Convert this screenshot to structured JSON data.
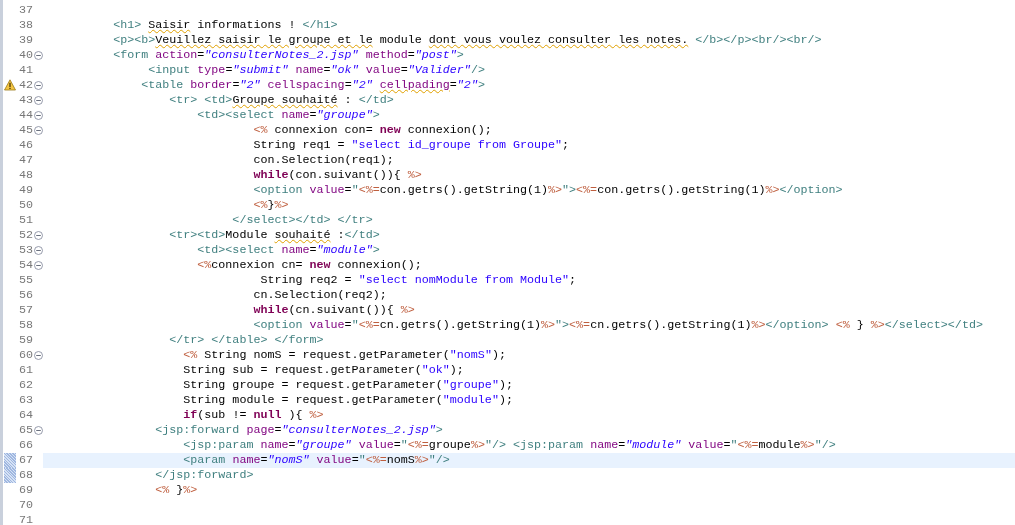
{
  "editor": {
    "lines": [
      {
        "number": "37",
        "fold": false,
        "warning": false,
        "changed": false,
        "current": false
      },
      {
        "number": "38",
        "fold": false,
        "warning": false,
        "changed": false,
        "current": false,
        "tokens": [
          {
            "kind": "tag",
            "text": "          <h1> "
          },
          {
            "kind": "misspelled",
            "text": "Saisir"
          },
          {
            "kind": "text",
            "text": " informations ! "
          },
          {
            "kind": "tag",
            "text": "</h1>"
          }
        ]
      },
      {
        "number": "39",
        "fold": false,
        "warning": false,
        "changed": false,
        "current": false,
        "tokens": [
          {
            "kind": "tag",
            "text": "          <p><b>"
          },
          {
            "kind": "misspelled",
            "text": "Veuillez saisir le groupe et le"
          },
          {
            "kind": "text",
            "text": " module "
          },
          {
            "kind": "misspelled",
            "text": "dont vous voulez consulter les notes."
          },
          {
            "kind": "tag",
            "text": " </b></p><br/><br/>"
          }
        ]
      },
      {
        "number": "40",
        "fold": true,
        "warning": false,
        "changed": false,
        "current": false,
        "tokens": [
          {
            "kind": "tag",
            "text": "          <form "
          },
          {
            "kind": "attr",
            "text": "action"
          },
          {
            "kind": "text",
            "text": "="
          },
          {
            "kind": "value",
            "text": "\"consulterNotes_2.jsp\" "
          },
          {
            "kind": "attr",
            "text": "method"
          },
          {
            "kind": "text",
            "text": "="
          },
          {
            "kind": "value",
            "text": "\"post\""
          },
          {
            "kind": "tag",
            "text": ">"
          }
        ]
      },
      {
        "number": "41",
        "fold": false,
        "warning": false,
        "changed": false,
        "current": false,
        "tokens": [
          {
            "kind": "tag",
            "text": "               <input "
          },
          {
            "kind": "attr",
            "text": "type"
          },
          {
            "kind": "text",
            "text": "="
          },
          {
            "kind": "value",
            "text": "\"submit\" "
          },
          {
            "kind": "attr",
            "text": "name"
          },
          {
            "kind": "text",
            "text": "="
          },
          {
            "kind": "value",
            "text": "\"ok\" "
          },
          {
            "kind": "attr",
            "text": "value"
          },
          {
            "kind": "text",
            "text": "="
          },
          {
            "kind": "value",
            "text": "\"Valider\""
          },
          {
            "kind": "tag",
            "text": "/>"
          }
        ]
      },
      {
        "number": "42",
        "fold": true,
        "warning": true,
        "changed": false,
        "current": false,
        "tokens": [
          {
            "kind": "tag",
            "text": "              <table "
          },
          {
            "kind": "attr",
            "text": "border"
          },
          {
            "kind": "text",
            "text": "="
          },
          {
            "kind": "value",
            "text": "\"2\" "
          },
          {
            "kind": "attr",
            "text": "cellspacing"
          },
          {
            "kind": "text",
            "text": "="
          },
          {
            "kind": "value",
            "text": "\"2\" "
          },
          {
            "kind": "misspelled-attr",
            "text": "cellpading"
          },
          {
            "kind": "text",
            "text": "="
          },
          {
            "kind": "value",
            "text": "\"2\""
          },
          {
            "kind": "tag",
            "text": ">"
          }
        ]
      },
      {
        "number": "43",
        "fold": true,
        "warning": false,
        "changed": false,
        "current": false,
        "tokens": [
          {
            "kind": "tag",
            "text": "                  <tr> <td>"
          },
          {
            "kind": "misspelled",
            "text": "Groupe souhaité"
          },
          {
            "kind": "text",
            "text": " : "
          },
          {
            "kind": "tag",
            "text": "</td>"
          }
        ]
      },
      {
        "number": "44",
        "fold": true,
        "warning": false,
        "changed": false,
        "current": false,
        "tokens": [
          {
            "kind": "tag",
            "text": "                      <td><select "
          },
          {
            "kind": "attr",
            "text": "name"
          },
          {
            "kind": "text",
            "text": "="
          },
          {
            "kind": "value",
            "text": "\"groupe\""
          },
          {
            "kind": "tag",
            "text": ">"
          }
        ]
      },
      {
        "number": "45",
        "fold": true,
        "warning": false,
        "changed": false,
        "current": false,
        "tokens": [
          {
            "kind": "jsp",
            "text": "                              <%"
          },
          {
            "kind": "text",
            "text": " connexion con= "
          },
          {
            "kind": "keyword",
            "text": "new"
          },
          {
            "kind": "text",
            "text": " connexion();"
          }
        ]
      },
      {
        "number": "46",
        "fold": false,
        "warning": false,
        "changed": false,
        "current": false,
        "tokens": [
          {
            "kind": "text",
            "text": "                              String req1 = "
          },
          {
            "kind": "string",
            "text": "\"select id_groupe from Groupe\""
          },
          {
            "kind": "text",
            "text": ";"
          }
        ]
      },
      {
        "number": "47",
        "fold": false,
        "warning": false,
        "changed": false,
        "current": false,
        "tokens": [
          {
            "kind": "text",
            "text": "                              con.Selection(req1);"
          }
        ]
      },
      {
        "number": "48",
        "fold": false,
        "warning": false,
        "changed": false,
        "current": false,
        "tokens": [
          {
            "kind": "keyword",
            "text": "                              while"
          },
          {
            "kind": "text",
            "text": "(con.suivant()){ "
          },
          {
            "kind": "jsp",
            "text": "%>"
          }
        ]
      },
      {
        "number": "49",
        "fold": false,
        "warning": false,
        "changed": false,
        "current": false,
        "tokens": [
          {
            "kind": "tag",
            "text": "                              <option "
          },
          {
            "kind": "attr",
            "text": "value"
          },
          {
            "kind": "text",
            "text": "="
          },
          {
            "kind": "quote",
            "text": "\""
          },
          {
            "kind": "jsp",
            "text": "<%="
          },
          {
            "kind": "text",
            "text": "con.getrs().getString(1)"
          },
          {
            "kind": "jsp",
            "text": "%>"
          },
          {
            "kind": "quote",
            "text": "\""
          },
          {
            "kind": "tag",
            "text": ">"
          },
          {
            "kind": "jsp",
            "text": "<%="
          },
          {
            "kind": "text",
            "text": "con.getrs().getString(1)"
          },
          {
            "kind": "jsp",
            "text": "%>"
          },
          {
            "kind": "tag",
            "text": "</option>"
          }
        ]
      },
      {
        "number": "50",
        "fold": false,
        "warning": false,
        "changed": false,
        "current": false,
        "tokens": [
          {
            "kind": "jsp",
            "text": "                              <%"
          },
          {
            "kind": "text",
            "text": "}"
          },
          {
            "kind": "jsp",
            "text": "%>"
          }
        ]
      },
      {
        "number": "51",
        "fold": false,
        "warning": false,
        "changed": false,
        "current": false,
        "tokens": [
          {
            "kind": "tag",
            "text": "                           </select></td> </tr>"
          }
        ]
      },
      {
        "number": "52",
        "fold": true,
        "warning": false,
        "changed": false,
        "current": false,
        "tokens": [
          {
            "kind": "tag",
            "text": "                  <tr><td>"
          },
          {
            "kind": "text",
            "text": "Module "
          },
          {
            "kind": "misspelled",
            "text": "souhaité"
          },
          {
            "kind": "text",
            "text": " :"
          },
          {
            "kind": "tag",
            "text": "</td>"
          }
        ]
      },
      {
        "number": "53",
        "fold": true,
        "warning": false,
        "changed": false,
        "current": false,
        "tokens": [
          {
            "kind": "tag",
            "text": "                      <td><select "
          },
          {
            "kind": "attr",
            "text": "name"
          },
          {
            "kind": "text",
            "text": "="
          },
          {
            "kind": "value",
            "text": "\"module\""
          },
          {
            "kind": "tag",
            "text": ">"
          }
        ]
      },
      {
        "number": "54",
        "fold": true,
        "warning": false,
        "changed": false,
        "current": false,
        "tokens": [
          {
            "kind": "jsp",
            "text": "                      <%"
          },
          {
            "kind": "text",
            "text": "connexion cn= "
          },
          {
            "kind": "keyword",
            "text": "new"
          },
          {
            "kind": "text",
            "text": " connexion();"
          }
        ]
      },
      {
        "number": "55",
        "fold": false,
        "warning": false,
        "changed": false,
        "current": false,
        "tokens": [
          {
            "kind": "text",
            "text": "                               String req2 = "
          },
          {
            "kind": "string",
            "text": "\"select nomModule from Module\""
          },
          {
            "kind": "text",
            "text": ";"
          }
        ]
      },
      {
        "number": "56",
        "fold": false,
        "warning": false,
        "changed": false,
        "current": false,
        "tokens": [
          {
            "kind": "text",
            "text": "                              cn.Selection(req2);"
          }
        ]
      },
      {
        "number": "57",
        "fold": false,
        "warning": false,
        "changed": false,
        "current": false,
        "tokens": [
          {
            "kind": "keyword",
            "text": "                              while"
          },
          {
            "kind": "text",
            "text": "(cn.suivant()){ "
          },
          {
            "kind": "jsp",
            "text": "%>"
          }
        ]
      },
      {
        "number": "58",
        "fold": false,
        "warning": false,
        "changed": false,
        "current": false,
        "tokens": [
          {
            "kind": "tag",
            "text": "                              <option "
          },
          {
            "kind": "attr",
            "text": "value"
          },
          {
            "kind": "text",
            "text": "="
          },
          {
            "kind": "quote",
            "text": "\""
          },
          {
            "kind": "jsp",
            "text": "<%="
          },
          {
            "kind": "text",
            "text": "cn.getrs().getString(1)"
          },
          {
            "kind": "jsp",
            "text": "%>"
          },
          {
            "kind": "quote",
            "text": "\""
          },
          {
            "kind": "tag",
            "text": ">"
          },
          {
            "kind": "jsp",
            "text": "<%="
          },
          {
            "kind": "text",
            "text": "cn.getrs().getString(1)"
          },
          {
            "kind": "jsp",
            "text": "%>"
          },
          {
            "kind": "tag",
            "text": "</option> "
          },
          {
            "kind": "jsp",
            "text": "<%"
          },
          {
            "kind": "text",
            "text": " } "
          },
          {
            "kind": "jsp",
            "text": "%>"
          },
          {
            "kind": "tag",
            "text": "</select></td>"
          }
        ]
      },
      {
        "number": "59",
        "fold": false,
        "warning": false,
        "changed": false,
        "current": false,
        "tokens": [
          {
            "kind": "tag",
            "text": "                  </tr> </table> </form>"
          }
        ]
      },
      {
        "number": "60",
        "fold": true,
        "warning": false,
        "changed": false,
        "current": false,
        "tokens": [
          {
            "kind": "jsp",
            "text": "                    <%"
          },
          {
            "kind": "text",
            "text": " String nomS = request.getParameter("
          },
          {
            "kind": "string",
            "text": "\"nomS\""
          },
          {
            "kind": "text",
            "text": ");"
          }
        ]
      },
      {
        "number": "61",
        "fold": false,
        "warning": false,
        "changed": false,
        "current": false,
        "tokens": [
          {
            "kind": "text",
            "text": "                    String sub = request.getParameter("
          },
          {
            "kind": "string",
            "text": "\"ok\""
          },
          {
            "kind": "text",
            "text": ");"
          }
        ]
      },
      {
        "number": "62",
        "fold": false,
        "warning": false,
        "changed": false,
        "current": false,
        "tokens": [
          {
            "kind": "text",
            "text": "                    String groupe = request.getParameter("
          },
          {
            "kind": "string",
            "text": "\"groupe\""
          },
          {
            "kind": "text",
            "text": ");"
          }
        ]
      },
      {
        "number": "63",
        "fold": false,
        "warning": false,
        "changed": false,
        "current": false,
        "tokens": [
          {
            "kind": "text",
            "text": "                    String module = request.getParameter("
          },
          {
            "kind": "string",
            "text": "\"module\""
          },
          {
            "kind": "text",
            "text": ");"
          }
        ]
      },
      {
        "number": "64",
        "fold": false,
        "warning": false,
        "changed": false,
        "current": false,
        "tokens": [
          {
            "kind": "keyword",
            "text": "                    if"
          },
          {
            "kind": "text",
            "text": "(sub != "
          },
          {
            "kind": "keyword",
            "text": "null"
          },
          {
            "kind": "text",
            "text": " ){ "
          },
          {
            "kind": "jsp",
            "text": "%>"
          }
        ]
      },
      {
        "number": "65",
        "fold": true,
        "warning": false,
        "changed": false,
        "current": false,
        "tokens": [
          {
            "kind": "tag",
            "text": "                <jsp:forward "
          },
          {
            "kind": "attr",
            "text": "page"
          },
          {
            "kind": "text",
            "text": "="
          },
          {
            "kind": "value",
            "text": "\"consulterNotes_2.jsp\""
          },
          {
            "kind": "tag",
            "text": ">"
          }
        ]
      },
      {
        "number": "66",
        "fold": false,
        "warning": false,
        "changed": false,
        "current": false,
        "tokens": [
          {
            "kind": "tag",
            "text": "                    <jsp:param "
          },
          {
            "kind": "attr",
            "text": "name"
          },
          {
            "kind": "text",
            "text": "="
          },
          {
            "kind": "value",
            "text": "\"groupe\" "
          },
          {
            "kind": "attr",
            "text": "value"
          },
          {
            "kind": "text",
            "text": "="
          },
          {
            "kind": "quote",
            "text": "\""
          },
          {
            "kind": "jsp",
            "text": "<%="
          },
          {
            "kind": "text",
            "text": "groupe"
          },
          {
            "kind": "jsp",
            "text": "%>"
          },
          {
            "kind": "quote",
            "text": "\""
          },
          {
            "kind": "tag",
            "text": "/> <jsp:param "
          },
          {
            "kind": "attr",
            "text": "name"
          },
          {
            "kind": "text",
            "text": "="
          },
          {
            "kind": "value",
            "text": "\"module\" "
          },
          {
            "kind": "attr",
            "text": "value"
          },
          {
            "kind": "text",
            "text": "="
          },
          {
            "kind": "quote",
            "text": "\""
          },
          {
            "kind": "jsp",
            "text": "<%="
          },
          {
            "kind": "text",
            "text": "module"
          },
          {
            "kind": "jsp",
            "text": "%>"
          },
          {
            "kind": "quote",
            "text": "\""
          },
          {
            "kind": "tag",
            "text": "/>"
          }
        ]
      },
      {
        "number": "67",
        "fold": false,
        "warning": false,
        "changed": true,
        "current": true,
        "tokens": [
          {
            "kind": "tag",
            "text": "                    <param "
          },
          {
            "kind": "attr",
            "text": "name"
          },
          {
            "kind": "text",
            "text": "="
          },
          {
            "kind": "value",
            "text": "\"nomS\" "
          },
          {
            "kind": "attr",
            "text": "value"
          },
          {
            "kind": "text",
            "text": "="
          },
          {
            "kind": "quote",
            "text": "\""
          },
          {
            "kind": "jsp",
            "text": "<%="
          },
          {
            "kind": "text",
            "text": "nomS"
          },
          {
            "kind": "jsp",
            "text": "%>"
          },
          {
            "kind": "quote",
            "text": "\""
          },
          {
            "kind": "tag",
            "text": "/>"
          }
        ]
      },
      {
        "number": "68",
        "fold": false,
        "warning": false,
        "changed": true,
        "current": false,
        "tokens": [
          {
            "kind": "tag",
            "text": "                </jsp:forward>"
          }
        ]
      },
      {
        "number": "69",
        "fold": false,
        "warning": false,
        "changed": false,
        "current": false,
        "tokens": [
          {
            "kind": "jsp",
            "text": "                <%"
          },
          {
            "kind": "text",
            "text": " }"
          },
          {
            "kind": "jsp",
            "text": "%>"
          }
        ]
      },
      {
        "number": "70",
        "fold": false,
        "warning": false,
        "changed": false,
        "current": false
      },
      {
        "number": "71",
        "fold": false,
        "warning": false,
        "changed": false,
        "current": false
      }
    ]
  }
}
